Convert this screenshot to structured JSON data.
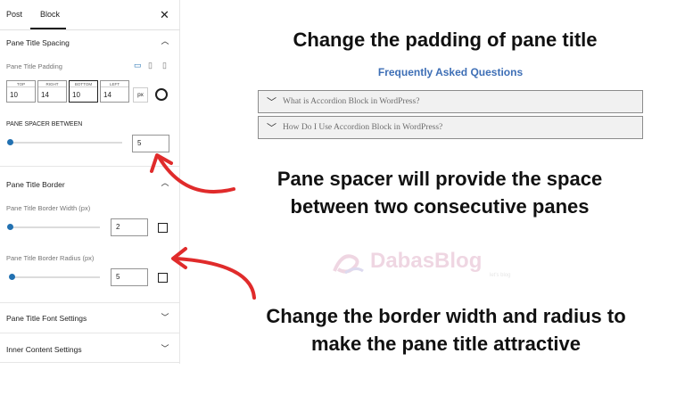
{
  "panel": {
    "tabs": [
      {
        "label": "Post"
      },
      {
        "label": "Block"
      }
    ],
    "close_icon": "close-icon",
    "spacing_section": {
      "title": "Pane Title Spacing",
      "padding_label": "Pane Title Padding",
      "device_icons": [
        "desktop-icon",
        "tablet-icon",
        "mobile-icon"
      ],
      "padding": [
        {
          "side": "TOP",
          "value": "10"
        },
        {
          "side": "RIGHT",
          "value": "14"
        },
        {
          "side": "BOTTOM",
          "value": "10"
        },
        {
          "side": "LEFT",
          "value": "14"
        }
      ],
      "unit": "px",
      "spacer_label": "PANE SPACER BETWEEN",
      "spacer_value": "5",
      "spacer_level": 0.0
    },
    "border_section": {
      "title": "Pane Title Border",
      "width_label": "Pane Title Border Width (px)",
      "width_value": "2",
      "width_level": 0.0,
      "radius_label": "Pane Title Border Radius (px)",
      "radius_value": "5",
      "radius_level": 0.02
    },
    "font_section": {
      "title": "Pane Title Font Settings"
    },
    "inner_section": {
      "title": "Inner Content Settings"
    }
  },
  "content": {
    "heading": "Change the padding of pane title",
    "faq_title": "Frequently Asked Questions",
    "panes": [
      {
        "title": "What is Accordion Block in WordPress?"
      },
      {
        "title": "How Do I Use Accordion Block in WordPress?"
      }
    ],
    "annotation_spacer": [
      "Pane spacer will provide the space",
      "between two consecutive panes"
    ],
    "annotation_border": [
      "Change the border width and radius to",
      "make the pane title attractive"
    ]
  },
  "watermark": {
    "text": "DabasBlog",
    "sub": "let's blog"
  },
  "colors": {
    "accent": "#2271b1",
    "faq_title": "#3e6fb6",
    "arrow": "#e02b2b",
    "pane_bg": "#f1f1f1"
  }
}
